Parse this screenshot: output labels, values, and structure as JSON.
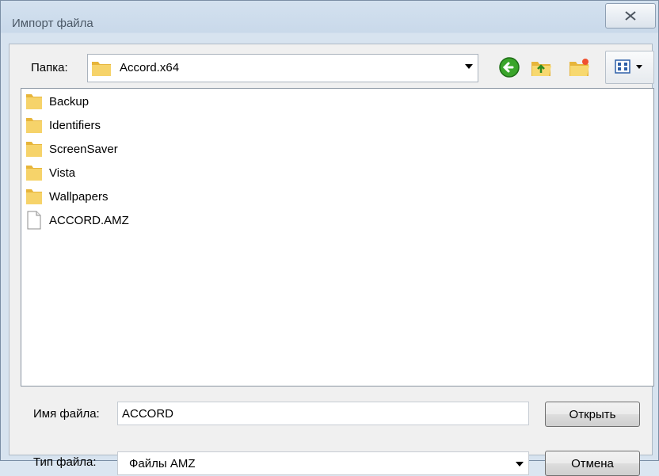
{
  "window": {
    "title": "Импорт файла",
    "close_glyph": "⌧"
  },
  "folder": {
    "label": "Папка:",
    "value": "Accord.x64"
  },
  "toolbar": {
    "icons": [
      "back-icon",
      "up-folder-icon",
      "new-folder-icon",
      "view-menu-icon"
    ]
  },
  "files": [
    {
      "name": "Backup",
      "type": "folder"
    },
    {
      "name": "Identifiers",
      "type": "folder"
    },
    {
      "name": "ScreenSaver",
      "type": "folder"
    },
    {
      "name": "Vista",
      "type": "folder"
    },
    {
      "name": "Wallpapers",
      "type": "folder"
    },
    {
      "name": "ACCORD.AMZ",
      "type": "file"
    }
  ],
  "filename": {
    "label": "Имя файла:",
    "value": "ACCORD"
  },
  "filetype": {
    "label": "Тип файла:",
    "value": "Файлы AMZ"
  },
  "buttons": {
    "open": "Открыть",
    "cancel": "Отмена"
  },
  "colors": {
    "accent": "#2e8b1e",
    "folder": "#f2c84b"
  }
}
